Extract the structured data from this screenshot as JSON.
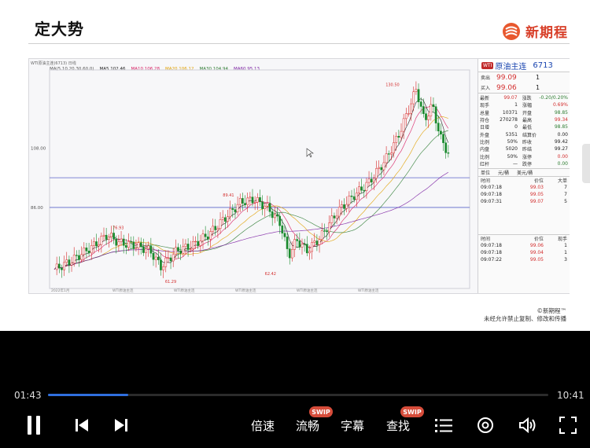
{
  "slide": {
    "title": "定大势",
    "brand": "新期程",
    "copyright_line1": "©新期程™",
    "copyright_line2": "未经允许禁止复制、修改和传播"
  },
  "chart": {
    "header": "WTI原油主连(6713) 日线",
    "ma_legend": [
      {
        "label": "MA(5,10,20,30,60,0)",
        "color": "#555555"
      },
      {
        "label": "MA5 102.46",
        "color": "#222222"
      },
      {
        "label": "MA10 106.28",
        "color": "#d81b60"
      },
      {
        "label": "MA20 106.12",
        "color": "#e0a000"
      },
      {
        "label": "MA30 104.94",
        "color": "#2e7d32"
      },
      {
        "label": "MA60 95.13",
        "color": "#7b1fa2"
      }
    ],
    "price_labels": [
      "108.00",
      "86.00"
    ],
    "annotations": [
      "130.50",
      "89.41",
      "76.93",
      "62.42",
      "61.29"
    ],
    "x_labels": [
      "2022年1月",
      "WTI原油主连",
      "WTI原油主连",
      "WTI原油主连",
      "WTI原油主连",
      "WTI原油主连"
    ],
    "colors": {
      "up": "#d62828",
      "down": "#1a8a2e",
      "hline": "#5b63c9"
    }
  },
  "quote": {
    "tag": "WTI",
    "name": "原油主连",
    "code": "6713",
    "sell_label": "卖出",
    "sell_price": "99.09",
    "sell_vol": "1",
    "buy_label": "买入",
    "buy_price": "99.06",
    "buy_vol": "1",
    "stats": [
      {
        "k1": "最新",
        "v1": "99.07",
        "c1": "red",
        "k2": "涨跌",
        "v2": "-0.20/0.20%",
        "c2": "green"
      },
      {
        "k1": "现手",
        "v1": "1",
        "c1": "",
        "k2": "涨幅",
        "v2": "0.69%",
        "c2": "red"
      },
      {
        "k1": "总量",
        "v1": "10371",
        "c1": "",
        "k2": "开盘",
        "v2": "98.85",
        "c2": "green"
      },
      {
        "k1": "持仓",
        "v1": "270278",
        "c1": "",
        "k2": "最高",
        "v2": "99.34",
        "c2": "red"
      },
      {
        "k1": "日增",
        "v1": "0",
        "c1": "",
        "k2": "最低",
        "v2": "98.85",
        "c2": "green"
      },
      {
        "k1": "外盘",
        "v1": "5351",
        "c1": "",
        "k2": "结算价",
        "v2": "0.00",
        "c2": ""
      },
      {
        "k1": "比例",
        "v1": "50%",
        "c1": "",
        "k2": "昨收",
        "v2": "99.42",
        "c2": ""
      },
      {
        "k1": "内盘",
        "v1": "5020",
        "c1": "",
        "k2": "昨结",
        "v2": "99.27",
        "c2": ""
      },
      {
        "k1": "比例",
        "v1": "50%",
        "c1": "",
        "k2": "涨停",
        "v2": "0.00",
        "c2": "red"
      },
      {
        "k1": "红杆",
        "v1": "—",
        "c1": "",
        "k2": "跌停",
        "v2": "0.00",
        "c2": "green"
      }
    ],
    "unit_left": "单位",
    "unit_mid": "元/桶",
    "unit_right": "美元/桶",
    "ticks_header": {
      "t": "时间",
      "p": "价位",
      "v": "大单"
    },
    "ticks_top": [
      {
        "t": "09:07:18",
        "p": "99.03",
        "v": "7"
      },
      {
        "t": "09:07:18",
        "p": "99.05",
        "v": "7"
      },
      {
        "t": "09:07:31",
        "p": "99.07",
        "v": "5"
      }
    ],
    "ticks_header2": {
      "t": "时间",
      "p": "价位",
      "v": "现手"
    },
    "ticks_bottom": [
      {
        "t": "09:07:18",
        "p": "99.06",
        "v": "1"
      },
      {
        "t": "09:07:18",
        "p": "99.04",
        "v": "1"
      },
      {
        "t": "09:07:22",
        "p": "99.05",
        "v": "3"
      }
    ]
  },
  "player": {
    "current_time": "01:43",
    "total_time": "10:41",
    "progress": 0.161,
    "speed_label": "倍速",
    "quality_label": "流畅",
    "subtitle_label": "字幕",
    "search_label": "查找",
    "badge": "SWIP"
  }
}
